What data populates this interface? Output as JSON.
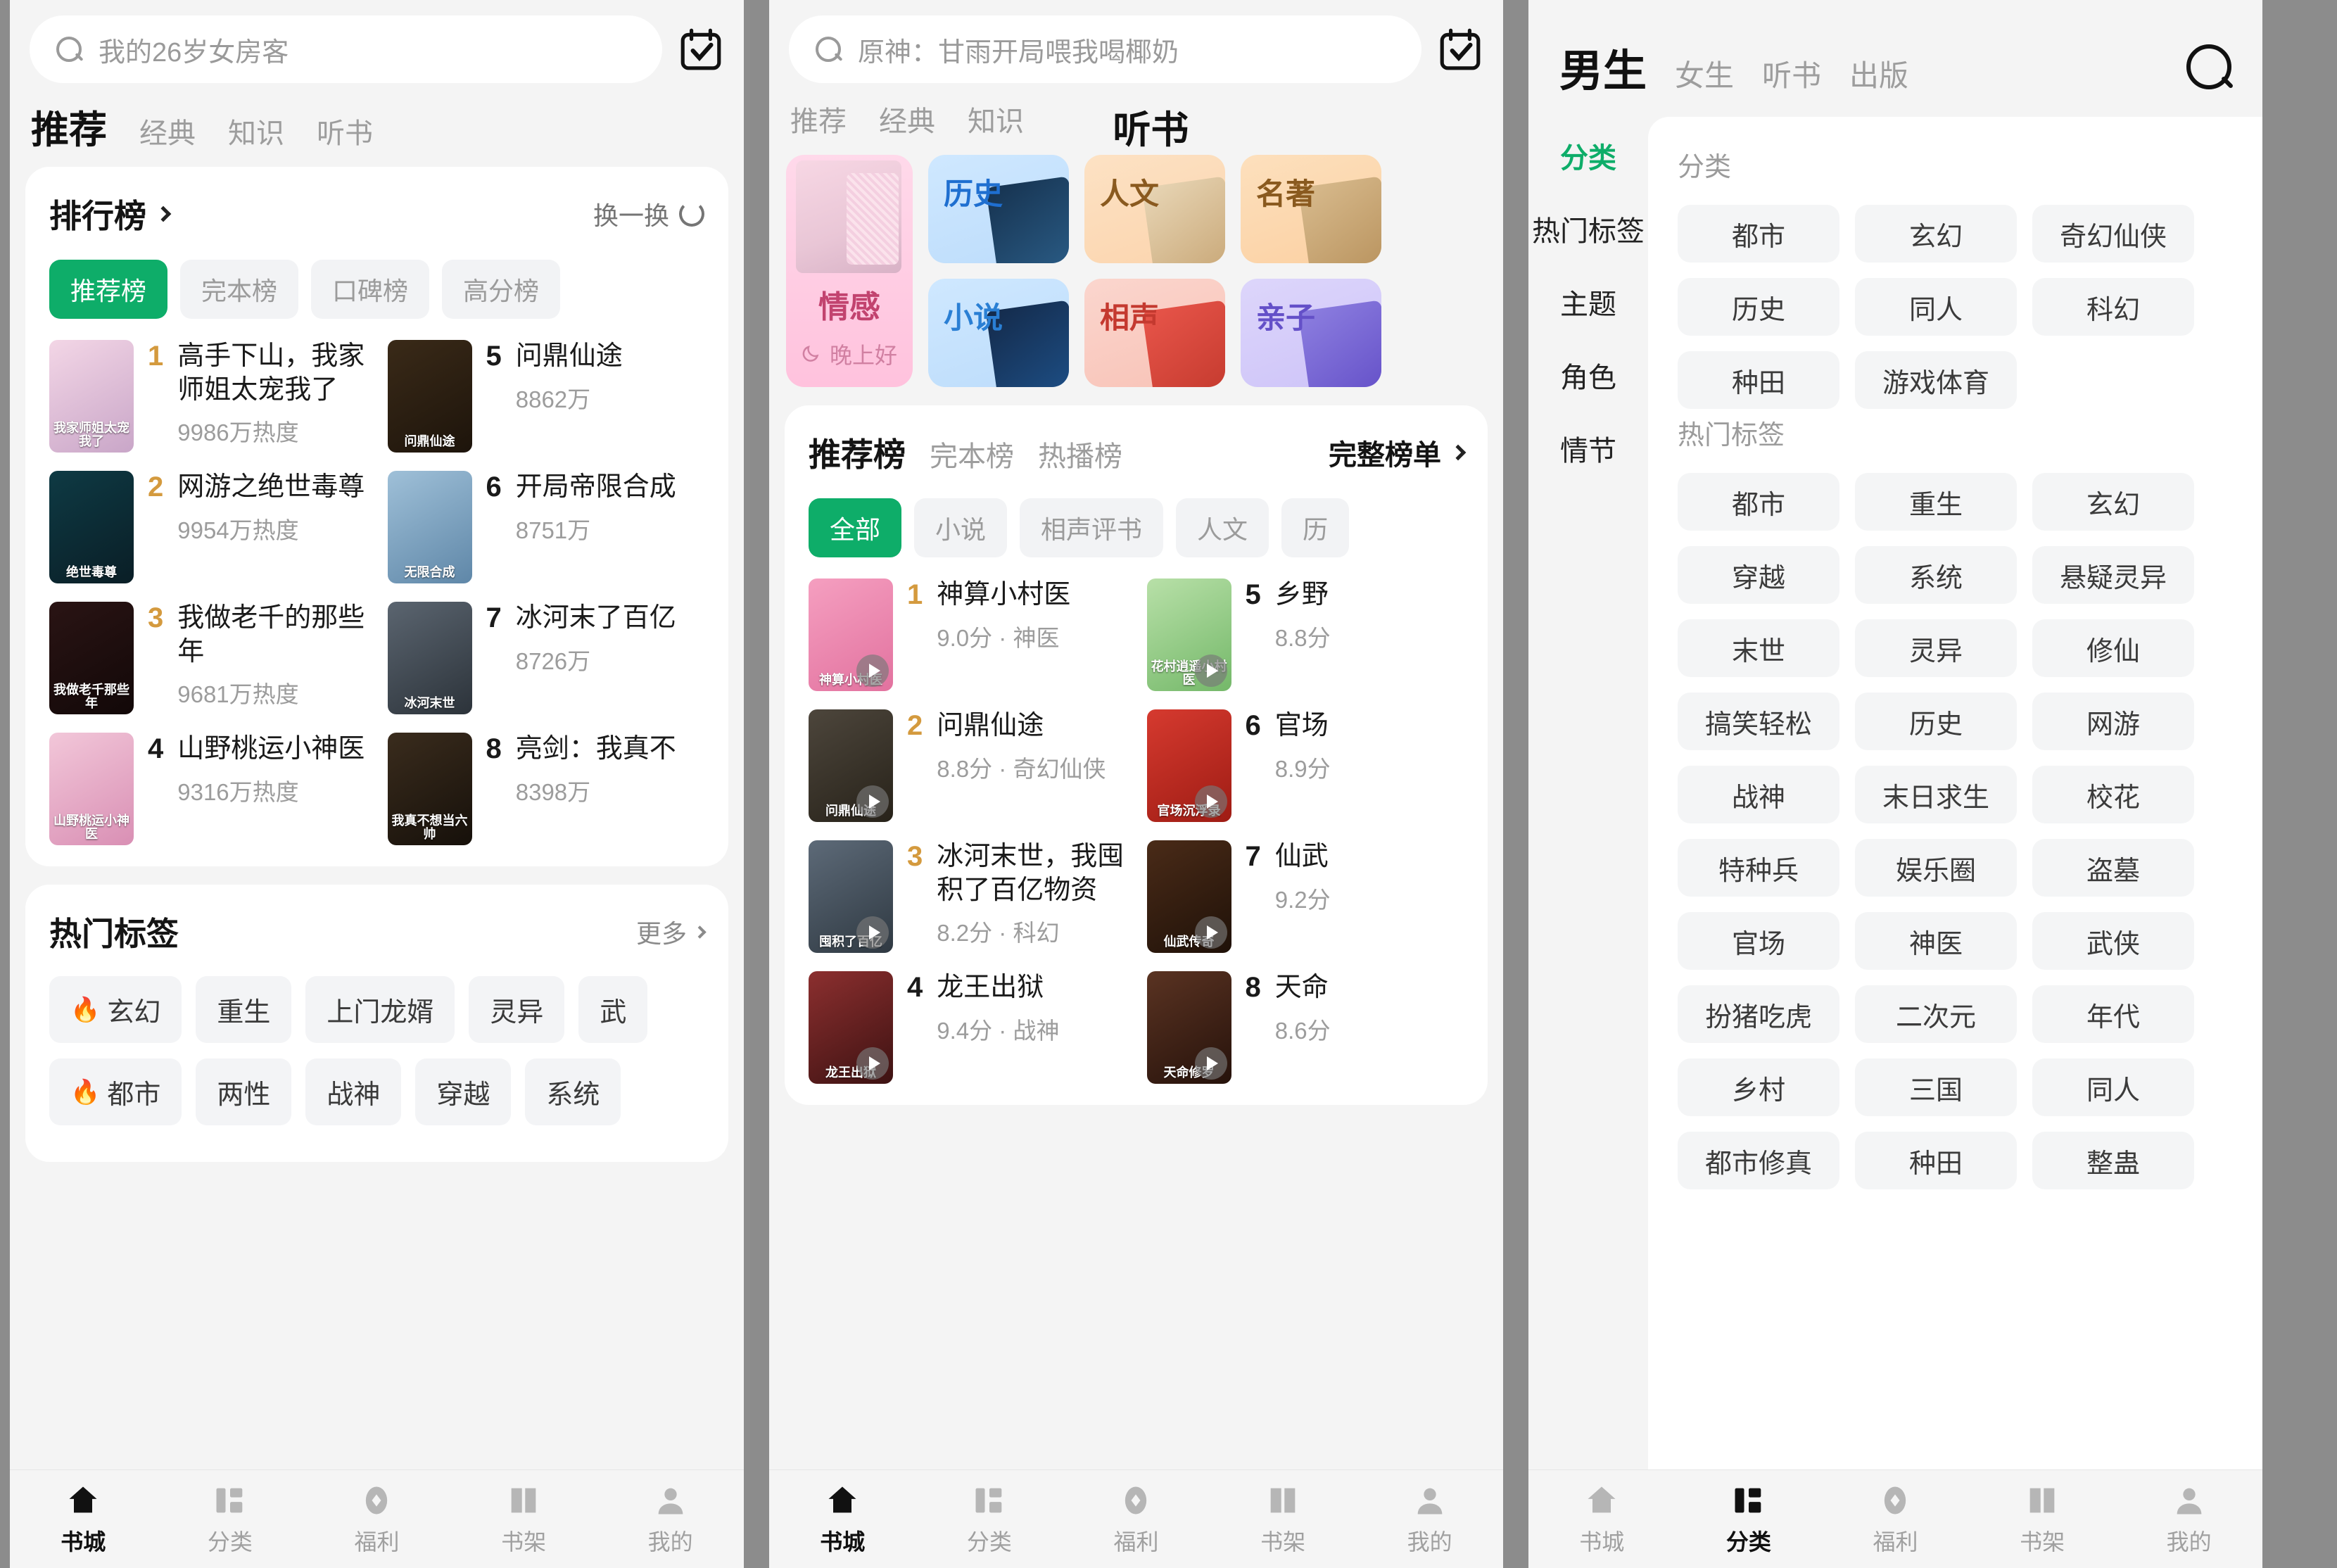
{
  "panel1": {
    "search": {
      "placeholder": "我的26岁女房客",
      "icon": "search-icon"
    },
    "checkin_icon": "calendar-check-icon",
    "tabs": [
      {
        "label": "推荐",
        "active": true
      },
      {
        "label": "经典",
        "active": false
      },
      {
        "label": "知识",
        "active": false
      },
      {
        "label": "听书",
        "active": false
      }
    ],
    "rank_card": {
      "title": "排行榜",
      "refresh_label": "换一换",
      "pills": [
        {
          "label": "推荐榜",
          "active": true
        },
        {
          "label": "完本榜",
          "active": false
        },
        {
          "label": "口碑榜",
          "active": false
        },
        {
          "label": "高分榜",
          "active": false
        }
      ],
      "left_items": [
        {
          "rank": "1",
          "title": "高手下山，我家师姐太宠我了",
          "meta": "9986万热度",
          "cover_text": "我家师姐太宠我了",
          "c1": "#f3d6e6",
          "c2": "#c9a6c8"
        },
        {
          "rank": "2",
          "title": "网游之绝世毒尊",
          "meta": "9954万热度",
          "cover_text": "绝世毒尊",
          "c1": "#0e3a44",
          "c2": "#0a1e26"
        },
        {
          "rank": "3",
          "title": "我做老千的那些年",
          "meta": "9681万热度",
          "cover_text": "我做老千那些年",
          "c1": "#2a1414",
          "c2": "#120808"
        },
        {
          "rank": "4",
          "title": "山野桃运小神医",
          "meta": "9316万热度",
          "cover_text": "山野桃运小神医",
          "c1": "#f2c7d9",
          "c2": "#d98fb4"
        }
      ],
      "right_items": [
        {
          "rank": "5",
          "title": "问鼎仙途",
          "meta": "8862万",
          "cover_text": "问鼎仙途",
          "c1": "#3a2a18",
          "c2": "#1d140b"
        },
        {
          "rank": "6",
          "title": "开局帝限合成",
          "meta": "8751万",
          "cover_text": "无限合成",
          "c1": "#9fc0d8",
          "c2": "#5f87a8"
        },
        {
          "rank": "7",
          "title": "冰河末了百亿",
          "meta": "8726万",
          "cover_text": "冰河末世",
          "c1": "#5b6570",
          "c2": "#2c333a"
        },
        {
          "rank": "8",
          "title": "亮剑：我真不",
          "meta": "8398万",
          "cover_text": "我真不想当六帅",
          "c1": "#3a2c1d",
          "c2": "#16100a"
        }
      ]
    },
    "tag_card": {
      "title": "热门标签",
      "more_label": "更多",
      "rows": [
        [
          {
            "label": "玄幻",
            "hot": true
          },
          {
            "label": "重生",
            "hot": false
          },
          {
            "label": "上门龙婿",
            "hot": false
          },
          {
            "label": "灵异",
            "hot": false
          },
          {
            "label": "武",
            "hot": false
          }
        ],
        [
          {
            "label": "都市",
            "hot": true
          },
          {
            "label": "两性",
            "hot": false
          },
          {
            "label": "战神",
            "hot": false
          },
          {
            "label": "穿越",
            "hot": false
          },
          {
            "label": "系统",
            "hot": false
          }
        ]
      ]
    },
    "bottom_nav": [
      {
        "label": "书城",
        "icon": "home-icon",
        "active": true
      },
      {
        "label": "分类",
        "icon": "category-icon",
        "active": false
      },
      {
        "label": "福利",
        "icon": "gift-icon",
        "active": false
      },
      {
        "label": "书架",
        "icon": "bookshelf-icon",
        "active": false
      },
      {
        "label": "我的",
        "icon": "user-icon",
        "active": false
      }
    ]
  },
  "panel2": {
    "search": {
      "placeholder": "原神：甘雨开局喂我喝椰奶",
      "icon": "search-icon"
    },
    "checkin_icon": "calendar-check-icon",
    "tabs": [
      {
        "label": "推荐",
        "active": false
      },
      {
        "label": "经典",
        "active": false
      },
      {
        "label": "知识",
        "active": false
      },
      {
        "label": "听书",
        "active": true
      }
    ],
    "featured": {
      "label": "情感",
      "sub": "晚上好",
      "moon_icon": "moon-icon"
    },
    "categories": [
      {
        "label": "历史",
        "color": "#1f6fd0",
        "bg1": "#cfe8ff",
        "bg2": "#bcdcfb",
        "art1": "#16324f",
        "art2": "#2a5c86"
      },
      {
        "label": "小说",
        "color": "#2a7fd4",
        "bg1": "#cfe8ff",
        "bg2": "#bcdcfb",
        "art1": "#142a4a",
        "art2": "#1d4f86"
      },
      {
        "label": "人文",
        "color": "#8a5a1f",
        "bg1": "#fde2c4",
        "bg2": "#fbd4ad",
        "art1": "#e8d6b6",
        "art2": "#c9a878"
      },
      {
        "label": "相声",
        "color": "#c4392f",
        "bg1": "#fbd6ce",
        "bg2": "#f8c2b6",
        "art1": "#e8554a",
        "art2": "#c43a2e"
      },
      {
        "label": "名著",
        "color": "#8a5a1f",
        "bg1": "#fde0bd",
        "bg2": "#fbd0a2",
        "art1": "#d8bb8e",
        "art2": "#b9935e"
      },
      {
        "label": "亲子",
        "color": "#6450c8",
        "bg1": "#ddd6fb",
        "bg2": "#cdc3f8",
        "art1": "#8d7fe0",
        "art2": "#6450c8"
      }
    ],
    "rank_card": {
      "tabs": [
        {
          "label": "推荐榜",
          "active": true
        },
        {
          "label": "完本榜",
          "active": false
        },
        {
          "label": "热播榜",
          "active": false
        }
      ],
      "full_list_label": "完整榜单",
      "pills": [
        {
          "label": "全部",
          "active": true
        },
        {
          "label": "小说",
          "active": false
        },
        {
          "label": "相声评书",
          "active": false
        },
        {
          "label": "人文",
          "active": false
        },
        {
          "label": "历",
          "active": false
        }
      ],
      "left_items": [
        {
          "rank": "1",
          "title": "神算小村医",
          "meta": "9.0分 · 神医",
          "cover_text": "神算小村医",
          "c1": "#f59fc0",
          "c2": "#e2729f"
        },
        {
          "rank": "2",
          "title": "问鼎仙途",
          "meta": "8.8分 · 奇幻仙侠",
          "cover_text": "问鼎仙途",
          "c1": "#4d463c",
          "c2": "#272219"
        },
        {
          "rank": "3",
          "title": "冰河末世，我囤积了百亿物资",
          "meta": "8.2分 · 科幻",
          "cover_text": "囤积了百亿",
          "c1": "#5d6a78",
          "c2": "#2f3942"
        },
        {
          "rank": "4",
          "title": "龙王出狱",
          "meta": "9.4分 · 战神",
          "cover_text": "龙王出狱",
          "c1": "#8c2f2f",
          "c2": "#3d1212"
        }
      ],
      "right_items": [
        {
          "rank": "5",
          "title": "乡野",
          "meta": "8.8分",
          "cover_text": "花村逍遥小村医",
          "c1": "#b8e0a8",
          "c2": "#74b869"
        },
        {
          "rank": "6",
          "title": "官场",
          "meta": "8.9分",
          "cover_text": "官场沉浮录",
          "c1": "#d63a2f",
          "c2": "#9e1c14"
        },
        {
          "rank": "7",
          "title": "仙武",
          "meta": "9.2分",
          "cover_text": "仙武传奇",
          "c1": "#4a2b18",
          "c2": "#1f1108"
        },
        {
          "rank": "8",
          "title": "天命",
          "meta": "8.6分",
          "cover_text": "天命修罗",
          "c1": "#5a3322",
          "c2": "#26120b"
        }
      ]
    },
    "bottom_nav": [
      {
        "label": "书城",
        "icon": "home-icon",
        "active": true
      },
      {
        "label": "分类",
        "icon": "category-icon",
        "active": false
      },
      {
        "label": "福利",
        "icon": "gift-icon",
        "active": false
      },
      {
        "label": "书架",
        "icon": "bookshelf-icon",
        "active": false
      },
      {
        "label": "我的",
        "icon": "user-icon",
        "active": false
      }
    ]
  },
  "panel3": {
    "tabs": [
      {
        "label": "男生",
        "active": true
      },
      {
        "label": "女生",
        "active": false
      },
      {
        "label": "听书",
        "active": false
      },
      {
        "label": "出版",
        "active": false
      }
    ],
    "search_icon": "search-icon",
    "side_items": [
      {
        "label": "分类",
        "active": true
      },
      {
        "label": "热门标签",
        "active": false
      },
      {
        "label": "主题",
        "active": false
      },
      {
        "label": "角色",
        "active": false
      },
      {
        "label": "情节",
        "active": false
      }
    ],
    "sections": [
      {
        "title": "分类",
        "chips": [
          "都市",
          "玄幻",
          "奇幻仙侠",
          "历史",
          "同人",
          "科幻",
          "种田",
          "游戏体育"
        ]
      },
      {
        "title": "热门标签",
        "chips": [
          "都市",
          "重生",
          "玄幻",
          "穿越",
          "系统",
          "悬疑灵异",
          "末世",
          "灵异",
          "修仙",
          "搞笑轻松",
          "历史",
          "网游",
          "战神",
          "末日求生",
          "校花",
          "特种兵",
          "娱乐圈",
          "盗墓",
          "官场",
          "神医",
          "武侠",
          "扮猪吃虎",
          "二次元",
          "年代",
          "乡村",
          "三国",
          "同人",
          "都市修真",
          "种田",
          "整蛊"
        ]
      }
    ],
    "bottom_nav": [
      {
        "label": "书城",
        "icon": "home-icon",
        "active": false
      },
      {
        "label": "分类",
        "icon": "category-icon",
        "active": true
      },
      {
        "label": "福利",
        "icon": "gift-icon",
        "active": false
      },
      {
        "label": "书架",
        "icon": "bookshelf-icon",
        "active": false
      },
      {
        "label": "我的",
        "icon": "user-icon",
        "active": false
      }
    ]
  },
  "theme": {
    "accent": "#0ead69",
    "gold": "#d49a3e",
    "muted": "#9b9b9b"
  }
}
